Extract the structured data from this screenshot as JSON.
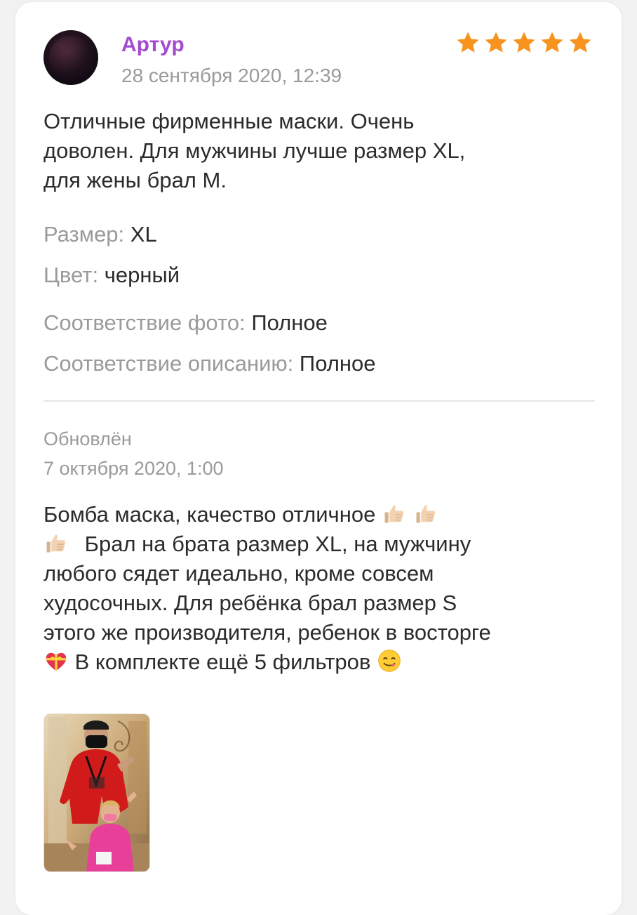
{
  "review": {
    "author": "Артур",
    "date": "28 сентября 2020, 12:39",
    "rating": 5,
    "rating_max": 5,
    "star_color": "#f7931e",
    "author_color": "#a44bd0",
    "text_line1": "Отличные фирменные маски. Очень",
    "text_line2": "доволен. Для мужчины лучше размер XL,",
    "text_line3": "для жены брал М.",
    "params": {
      "size_label": "Размер:",
      "size_value": "XL",
      "color_label": "Цвет:",
      "color_value": "черный",
      "photo_match_label": "Соответствие фото:",
      "photo_match_value": "Полное",
      "description_match_label": "Соответствие описанию:",
      "description_match_value": "Полное"
    }
  },
  "update": {
    "label": "Обновлён",
    "date": "7 октября 2020, 1:00",
    "line1": "Бомба маска, качество отличное",
    "line2": "Брал на брата размер XL, на мужчину",
    "line3": "любого сядет идеально, кроме совсем",
    "line4": "худосочных.  Для ребёнка брал размер S",
    "line5": "этого же производителя, ребенок в восторге",
    "line6": "В комплекте ещё 5 фильтров",
    "emojis": [
      "thumbs-up-icon",
      "thumbs-up-icon",
      "thumbs-up-icon",
      "heart-with-ribbon-icon",
      "face-savoring-food-icon"
    ]
  },
  "attachment": {
    "type": "photo"
  }
}
